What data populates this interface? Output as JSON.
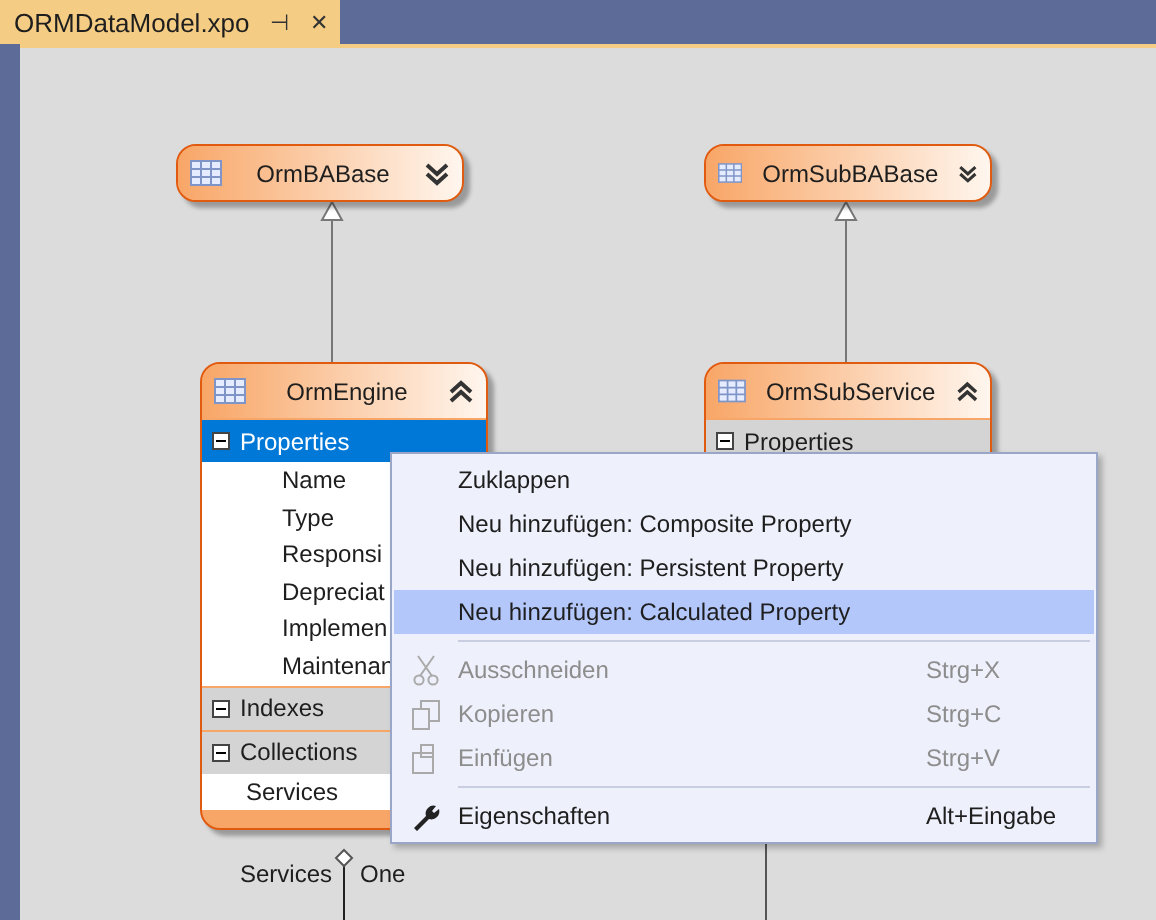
{
  "tab": {
    "title": "ORMDataModel.xpo",
    "pin": "⊣",
    "close": "✕"
  },
  "nodes": [
    {
      "name": "OrmBABase",
      "expanded": false
    },
    {
      "name": "OrmSubBABase",
      "expanded": false
    },
    {
      "name": "OrmEngine",
      "expanded": true,
      "sections": [
        {
          "title": "Properties",
          "expanded": true,
          "selected": true,
          "items": [
            "Name",
            "Type",
            "Responsi",
            "Depreciat",
            "Implemen",
            "Maintenan"
          ]
        },
        {
          "title": "Indexes",
          "expanded": true,
          "selected": false
        },
        {
          "title": "Collections",
          "expanded": true,
          "selected": false,
          "items": [
            "Services"
          ]
        }
      ]
    },
    {
      "name": "OrmSubService",
      "expanded": true,
      "sections": [
        {
          "title": "Properties",
          "expanded": true,
          "selected": false
        }
      ]
    }
  ],
  "association": {
    "name": "Services",
    "multiplicity": "One"
  },
  "context_menu": {
    "groups": [
      [
        {
          "label": "Zuklappen",
          "disabled": false,
          "selected": false
        },
        {
          "label": "Neu hinzufügen: Composite Property",
          "disabled": false,
          "selected": false
        },
        {
          "label": "Neu hinzufügen: Persistent Property",
          "disabled": false,
          "selected": false
        },
        {
          "label": "Neu hinzufügen: Calculated Property",
          "disabled": false,
          "selected": true
        }
      ],
      [
        {
          "label": "Ausschneiden",
          "shortcut": "Strg+X",
          "disabled": true,
          "selected": false
        },
        {
          "label": "Kopieren",
          "shortcut": "Strg+C",
          "disabled": true,
          "selected": false
        },
        {
          "label": "Einfügen",
          "shortcut": "Strg+V",
          "disabled": true,
          "selected": false
        }
      ],
      [
        {
          "label": "Eigenschaften",
          "shortcut": "Alt+Eingabe",
          "disabled": false,
          "selected": false
        }
      ]
    ]
  }
}
